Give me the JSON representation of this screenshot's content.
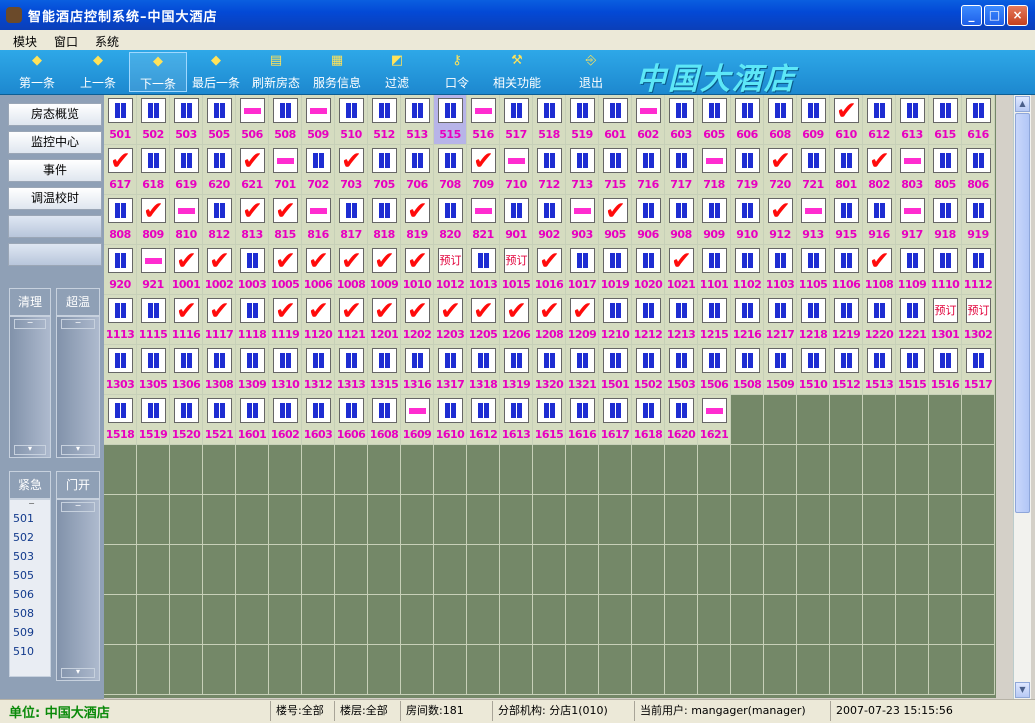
{
  "window": {
    "title": "智能酒店控制系统–中国大酒店",
    "buttons": [
      "_",
      "□",
      "×"
    ]
  },
  "menu": [
    "模块",
    "窗口",
    "系统"
  ],
  "toolbar": [
    {
      "label": "第一条",
      "icon": "◆"
    },
    {
      "label": "上一条",
      "icon": "◆"
    },
    {
      "label": "下一条",
      "icon": "◆",
      "active": true
    },
    {
      "label": "最后一条",
      "icon": "◆"
    },
    {
      "label": "刷新房态",
      "icon": "▤"
    },
    {
      "label": "服务信息",
      "icon": "▦"
    },
    {
      "label": "过滤",
      "icon": "◩"
    },
    {
      "label": "口令",
      "icon": "⚷"
    },
    {
      "label": "相关功能",
      "icon": "⚒"
    },
    {
      "label": "退出",
      "icon": "⎆"
    }
  ],
  "brand": "中国大酒店",
  "nav": [
    "房态概览",
    "监控中心",
    "事件",
    "调温校时",
    "",
    ""
  ],
  "panels": {
    "clean": "清理",
    "over_temp": "超温",
    "emergency": "紧急",
    "door_open": "门开",
    "alarm_rooms": [
      "501",
      "502",
      "503",
      "505",
      "506",
      "508",
      "509",
      "510"
    ]
  },
  "rooms": {
    "columns": 27,
    "selected": "515",
    "list": [
      [
        "501",
        "o"
      ],
      [
        "502",
        "o"
      ],
      [
        "503",
        "o"
      ],
      [
        "505",
        "o"
      ],
      [
        "506",
        "v"
      ],
      [
        "508",
        "o"
      ],
      [
        "509",
        "v"
      ],
      [
        "510",
        "o"
      ],
      [
        "512",
        "o"
      ],
      [
        "513",
        "o"
      ],
      [
        "515",
        "o"
      ],
      [
        "516",
        "v"
      ],
      [
        "517",
        "o"
      ],
      [
        "518",
        "o"
      ],
      [
        "519",
        "o"
      ],
      [
        "601",
        "o"
      ],
      [
        "602",
        "v"
      ],
      [
        "603",
        "o"
      ],
      [
        "605",
        "o"
      ],
      [
        "606",
        "o"
      ],
      [
        "608",
        "o"
      ],
      [
        "609",
        "o"
      ],
      [
        "610",
        "c"
      ],
      [
        "612",
        "o"
      ],
      [
        "613",
        "o"
      ],
      [
        "615",
        "o"
      ],
      [
        "616",
        "o"
      ],
      [
        "617",
        "c"
      ],
      [
        "618",
        "o"
      ],
      [
        "619",
        "o"
      ],
      [
        "620",
        "o"
      ],
      [
        "621",
        "c"
      ],
      [
        "701",
        "v"
      ],
      [
        "702",
        "o"
      ],
      [
        "703",
        "c"
      ],
      [
        "705",
        "o"
      ],
      [
        "706",
        "o"
      ],
      [
        "708",
        "o"
      ],
      [
        "709",
        "c"
      ],
      [
        "710",
        "v"
      ],
      [
        "712",
        "o"
      ],
      [
        "713",
        "o"
      ],
      [
        "715",
        "o"
      ],
      [
        "716",
        "o"
      ],
      [
        "717",
        "o"
      ],
      [
        "718",
        "v"
      ],
      [
        "719",
        "o"
      ],
      [
        "720",
        "c"
      ],
      [
        "721",
        "o"
      ],
      [
        "801",
        "o"
      ],
      [
        "802",
        "c"
      ],
      [
        "803",
        "v"
      ],
      [
        "805",
        "o"
      ],
      [
        "806",
        "o"
      ],
      [
        "808",
        "o"
      ],
      [
        "809",
        "c"
      ],
      [
        "810",
        "v"
      ],
      [
        "812",
        "o"
      ],
      [
        "813",
        "c"
      ],
      [
        "815",
        "c"
      ],
      [
        "816",
        "v"
      ],
      [
        "817",
        "o"
      ],
      [
        "818",
        "o"
      ],
      [
        "819",
        "c"
      ],
      [
        "820",
        "o"
      ],
      [
        "821",
        "v"
      ],
      [
        "901",
        "o"
      ],
      [
        "902",
        "o"
      ],
      [
        "903",
        "v"
      ],
      [
        "905",
        "c"
      ],
      [
        "906",
        "o"
      ],
      [
        "908",
        "o"
      ],
      [
        "909",
        "o"
      ],
      [
        "910",
        "o"
      ],
      [
        "912",
        "c"
      ],
      [
        "913",
        "v"
      ],
      [
        "915",
        "o"
      ],
      [
        "916",
        "o"
      ],
      [
        "917",
        "v"
      ],
      [
        "918",
        "o"
      ],
      [
        "919",
        "o"
      ],
      [
        "920",
        "o"
      ],
      [
        "921",
        "v"
      ],
      [
        "1001",
        "c"
      ],
      [
        "1002",
        "c"
      ],
      [
        "1003",
        "o"
      ],
      [
        "1005",
        "c"
      ],
      [
        "1006",
        "c"
      ],
      [
        "1008",
        "c"
      ],
      [
        "1009",
        "c"
      ],
      [
        "1010",
        "c"
      ],
      [
        "1012",
        "b"
      ],
      [
        "1013",
        "o"
      ],
      [
        "1015",
        "b"
      ],
      [
        "1016",
        "c"
      ],
      [
        "1017",
        "o"
      ],
      [
        "1019",
        "o"
      ],
      [
        "1020",
        "o"
      ],
      [
        "1021",
        "c"
      ],
      [
        "1101",
        "o"
      ],
      [
        "1102",
        "o"
      ],
      [
        "1103",
        "o"
      ],
      [
        "1105",
        "o"
      ],
      [
        "1106",
        "o"
      ],
      [
        "1108",
        "c"
      ],
      [
        "1109",
        "o"
      ],
      [
        "1110",
        "o"
      ],
      [
        "1112",
        "o"
      ],
      [
        "1113",
        "o"
      ],
      [
        "1115",
        "o"
      ],
      [
        "1116",
        "c"
      ],
      [
        "1117",
        "c"
      ],
      [
        "1118",
        "o"
      ],
      [
        "1119",
        "c"
      ],
      [
        "1120",
        "c"
      ],
      [
        "1121",
        "c"
      ],
      [
        "1201",
        "c"
      ],
      [
        "1202",
        "c"
      ],
      [
        "1203",
        "c"
      ],
      [
        "1205",
        "c"
      ],
      [
        "1206",
        "c"
      ],
      [
        "1208",
        "c"
      ],
      [
        "1209",
        "c"
      ],
      [
        "1210",
        "o"
      ],
      [
        "1212",
        "o"
      ],
      [
        "1213",
        "o"
      ],
      [
        "1215",
        "o"
      ],
      [
        "1216",
        "o"
      ],
      [
        "1217",
        "o"
      ],
      [
        "1218",
        "o"
      ],
      [
        "1219",
        "o"
      ],
      [
        "1220",
        "o"
      ],
      [
        "1221",
        "o"
      ],
      [
        "1301",
        "b"
      ],
      [
        "1302",
        "b"
      ],
      [
        "1303",
        "o"
      ],
      [
        "1305",
        "o"
      ],
      [
        "1306",
        "o"
      ],
      [
        "1308",
        "o"
      ],
      [
        "1309",
        "o"
      ],
      [
        "1310",
        "o"
      ],
      [
        "1312",
        "o"
      ],
      [
        "1313",
        "o"
      ],
      [
        "1315",
        "o"
      ],
      [
        "1316",
        "o"
      ],
      [
        "1317",
        "o"
      ],
      [
        "1318",
        "o"
      ],
      [
        "1319",
        "o"
      ],
      [
        "1320",
        "o"
      ],
      [
        "1321",
        "o"
      ],
      [
        "1501",
        "o"
      ],
      [
        "1502",
        "o"
      ],
      [
        "1503",
        "o"
      ],
      [
        "1506",
        "o"
      ],
      [
        "1508",
        "o"
      ],
      [
        "1509",
        "o"
      ],
      [
        "1510",
        "o"
      ],
      [
        "1512",
        "o"
      ],
      [
        "1513",
        "o"
      ],
      [
        "1515",
        "o"
      ],
      [
        "1516",
        "o"
      ],
      [
        "1517",
        "o"
      ],
      [
        "1518",
        "o"
      ],
      [
        "1519",
        "o"
      ],
      [
        "1520",
        "o"
      ],
      [
        "1521",
        "o"
      ],
      [
        "1601",
        "o"
      ],
      [
        "1602",
        "o"
      ],
      [
        "1603",
        "o"
      ],
      [
        "1606",
        "o"
      ],
      [
        "1608",
        "o"
      ],
      [
        "1609",
        "v"
      ],
      [
        "1610",
        "o"
      ],
      [
        "1612",
        "o"
      ],
      [
        "1613",
        "o"
      ],
      [
        "1615",
        "o"
      ],
      [
        "1616",
        "o"
      ],
      [
        "1617",
        "o"
      ],
      [
        "1618",
        "o"
      ],
      [
        "1620",
        "o"
      ],
      [
        "1621",
        "v"
      ]
    ],
    "icons": {
      "o": "occupied-icon",
      "v": "vacant-icon",
      "c": "checked-icon",
      "b": "reserved-icon"
    },
    "checkmark": "✔",
    "reserved_text": "预订"
  },
  "status": {
    "unit": "单位: 中国大酒店",
    "building": "楼号:全部",
    "floor": "楼层:全部",
    "room_count": "房间数:181",
    "branch": "分部机构: 分店1(010)",
    "user": "当前用户: mangager(manager)",
    "datetime": "2007-07-23 15:15:56"
  }
}
